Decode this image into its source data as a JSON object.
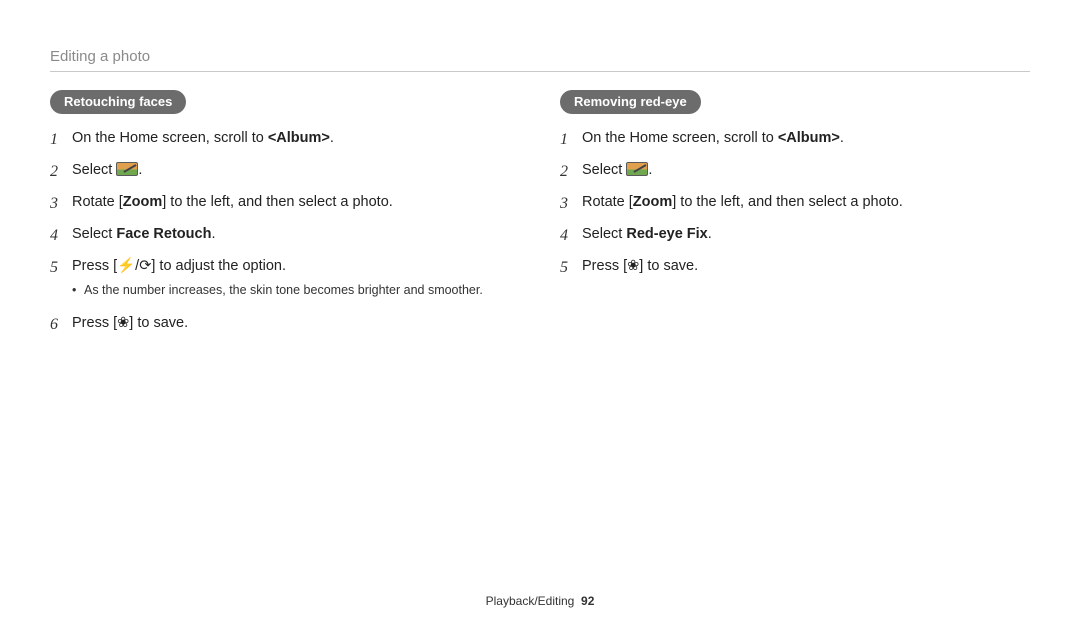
{
  "header": {
    "title": "Editing a photo"
  },
  "left": {
    "heading": "Retouching faces",
    "steps": [
      {
        "n": "1",
        "pre": "On the Home screen, scroll to ",
        "bold": "<Album>",
        "post": "."
      },
      {
        "n": "2",
        "pre": "Select ",
        "icon": "edit",
        "post": "."
      },
      {
        "n": "3",
        "pre": "Rotate [",
        "bold": "Zoom",
        "post": "] to the left, and then select a photo."
      },
      {
        "n": "4",
        "pre": "Select ",
        "bold": "Face Retouch",
        "post": "."
      },
      {
        "n": "5",
        "pre": "Press [",
        "sym": "⚡/⟳",
        "post": "] to adjust the option.",
        "bullets": [
          "As the number increases, the skin tone becomes brighter and smoother."
        ]
      },
      {
        "n": "6",
        "pre": "Press [",
        "sym": "❀",
        "post": "] to save."
      }
    ]
  },
  "right": {
    "heading": "Removing red-eye",
    "steps": [
      {
        "n": "1",
        "pre": "On the Home screen, scroll to ",
        "bold": "<Album>",
        "post": "."
      },
      {
        "n": "2",
        "pre": "Select ",
        "icon": "edit",
        "post": "."
      },
      {
        "n": "3",
        "pre": "Rotate [",
        "bold": "Zoom",
        "post": "] to the left, and then select a photo."
      },
      {
        "n": "4",
        "pre": "Select ",
        "bold": "Red-eye Fix",
        "post": "."
      },
      {
        "n": "5",
        "pre": "Press [",
        "sym": "❀",
        "post": "] to save."
      }
    ]
  },
  "footer": {
    "section": "Playback/Editing",
    "page": "92"
  }
}
